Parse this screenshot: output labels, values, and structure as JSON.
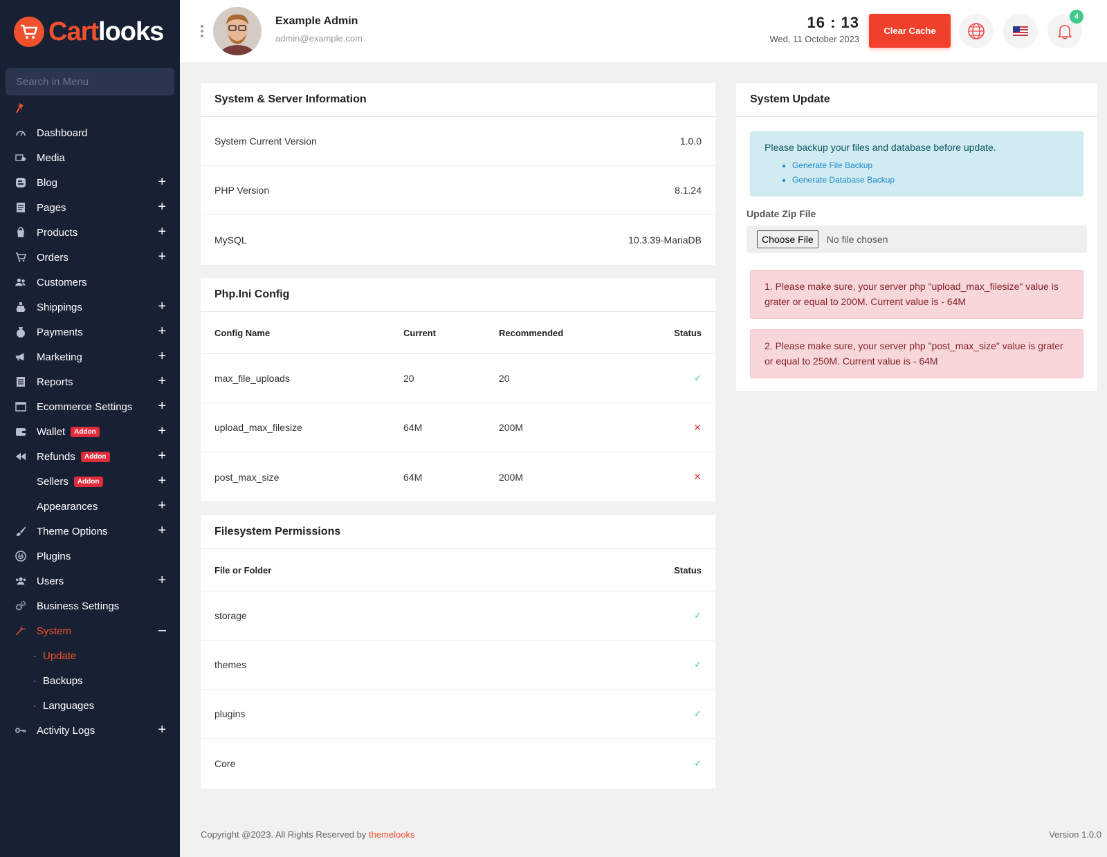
{
  "brand": {
    "name_part1": "Cart",
    "name_part2": "looks"
  },
  "sidebar": {
    "search_placeholder": "Search in Menu",
    "items": [
      {
        "label": "Dashboard",
        "icon": "gauge-icon",
        "expandable": false
      },
      {
        "label": "Media",
        "icon": "media-icon",
        "expandable": false
      },
      {
        "label": "Blog",
        "icon": "blog-icon",
        "expandable": true
      },
      {
        "label": "Pages",
        "icon": "pages-icon",
        "expandable": true
      },
      {
        "label": "Products",
        "icon": "products-icon",
        "expandable": true
      },
      {
        "label": "Orders",
        "icon": "cart-icon",
        "expandable": true
      },
      {
        "label": "Customers",
        "icon": "customers-icon",
        "expandable": false
      },
      {
        "label": "Shippings",
        "icon": "ship-icon",
        "expandable": true
      },
      {
        "label": "Payments",
        "icon": "payments-icon",
        "expandable": true
      },
      {
        "label": "Marketing",
        "icon": "megaphone-icon",
        "expandable": true
      },
      {
        "label": "Reports",
        "icon": "reports-icon",
        "expandable": true
      },
      {
        "label": "Ecommerce Settings",
        "icon": "window-icon",
        "expandable": true
      },
      {
        "label": "Wallet",
        "icon": "wallet-icon",
        "expandable": true,
        "badge": "Addon"
      },
      {
        "label": "Refunds",
        "icon": "rewind-icon",
        "expandable": true,
        "badge": "Addon"
      },
      {
        "label": "Sellers",
        "icon": "",
        "expandable": true,
        "badge": "Addon"
      },
      {
        "label": "Appearances",
        "icon": "",
        "expandable": true
      },
      {
        "label": "Theme Options",
        "icon": "brush-icon",
        "expandable": true
      },
      {
        "label": "Plugins",
        "icon": "plugin-icon",
        "expandable": false
      },
      {
        "label": "Users",
        "icon": "users-icon",
        "expandable": true
      },
      {
        "label": "Business Settings",
        "icon": "gears-icon",
        "expandable": false
      },
      {
        "label": "System",
        "icon": "wrench-icon",
        "expandable": "open",
        "active": true
      },
      {
        "label": "Activity Logs",
        "icon": "key-icon",
        "expandable": true
      }
    ],
    "system_submenu": [
      "Update",
      "Backups",
      "Languages"
    ],
    "plus": "+",
    "minus": "–",
    "dash": "-"
  },
  "header": {
    "user_name": "Example Admin",
    "user_email": "admin@example.com",
    "time": "16 : 13",
    "date": "Wed, 11 October 2023",
    "clear_cache": "Clear Cache",
    "notification_count": "4"
  },
  "server_info": {
    "title": "System & Server Information",
    "rows": [
      {
        "label": "System Current Version",
        "value": "1.0.0"
      },
      {
        "label": "PHP Version",
        "value": "8.1.24"
      },
      {
        "label": "MySQL",
        "value": "10.3.39-MariaDB"
      }
    ]
  },
  "php_ini": {
    "title": "Php.Ini Config",
    "columns": [
      "Config Name",
      "Current",
      "Recommended",
      "Status"
    ],
    "rows": [
      {
        "name": "max_file_uploads",
        "current": "20",
        "recommended": "20",
        "status": "✓"
      },
      {
        "name": "upload_max_filesize",
        "current": "64M",
        "recommended": "200M",
        "status": "✕"
      },
      {
        "name": "post_max_size",
        "current": "64M",
        "recommended": "200M",
        "status": "✕"
      }
    ]
  },
  "filesystem": {
    "title": "Filesystem Permissions",
    "columns": [
      "File or Folder",
      "Status"
    ],
    "rows": [
      {
        "name": "storage",
        "status": "✓"
      },
      {
        "name": "themes",
        "status": "✓"
      },
      {
        "name": "plugins",
        "status": "✓"
      },
      {
        "name": "Core",
        "status": "✓"
      }
    ]
  },
  "system_update": {
    "title": "System Update",
    "backup_notice": "Please backup your files and database before update.",
    "links": [
      "Generate File Backup",
      "Generate Database Backup"
    ],
    "zip_label": "Update Zip File",
    "choose_file": "Choose File",
    "no_file": "No file chosen",
    "warnings": [
      "1. Please make sure, your server php \"upload_max_filesize\" value is grater or equal to 200M. Current value is - 64M",
      "2. Please make sure, your server php \"post_max_size\" value is grater or equal to 250M. Current value is - 64M"
    ]
  },
  "footer": {
    "copyright": "Copyright @2023. All Rights Reserved by ",
    "company": "themelooks",
    "version": "Version 1.0.0"
  },
  "colors": {
    "accent": "#f0512d",
    "sidebar_bg": "#182133",
    "success": "#3dc988",
    "danger": "#f04848"
  }
}
